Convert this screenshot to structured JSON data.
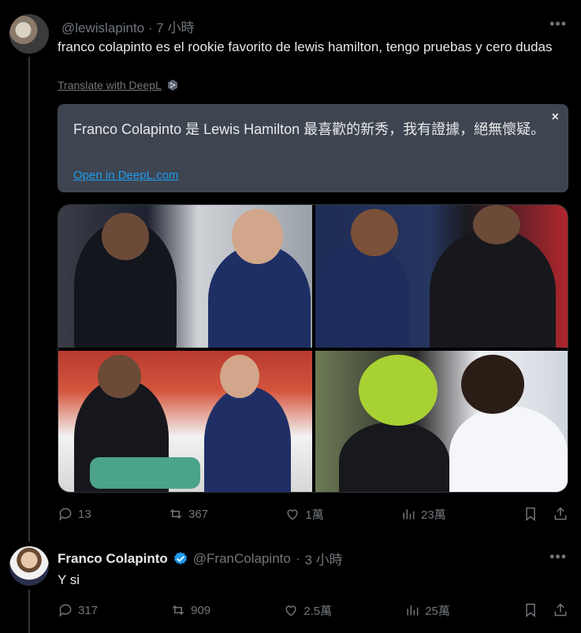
{
  "tweet1": {
    "handle": "@lewislapinto",
    "time": "7 小時",
    "text": "franco colapinto es el rookie favorito de lewis hamilton, tengo pruebas y cero dudas",
    "translate_label": "Translate with DeepL",
    "translation": {
      "text": "Franco Colapinto 是 Lewis Hamilton 最喜歡的新秀，我有證據，絕無懷疑。",
      "open_link": "Open in DeepL.com",
      "close": "×"
    },
    "media": [
      {
        "alt": "photo-1"
      },
      {
        "alt": "photo-2"
      },
      {
        "alt": "photo-3"
      },
      {
        "alt": "photo-4"
      }
    ],
    "stats": {
      "replies": "13",
      "reposts": "367",
      "likes": "1萬",
      "views": "23萬"
    }
  },
  "tweet2": {
    "name": "Franco Colapinto",
    "handle": "@FranColapinto",
    "time": "3 小時",
    "text": "Y si",
    "stats": {
      "replies": "317",
      "reposts": "909",
      "likes": "2.5萬",
      "views": "25萬"
    }
  },
  "more_label": "•••",
  "colors": {
    "background": "#000000",
    "accent": "#1d9bf0",
    "muted": "#71767b",
    "translate_box": "#3e4550"
  }
}
